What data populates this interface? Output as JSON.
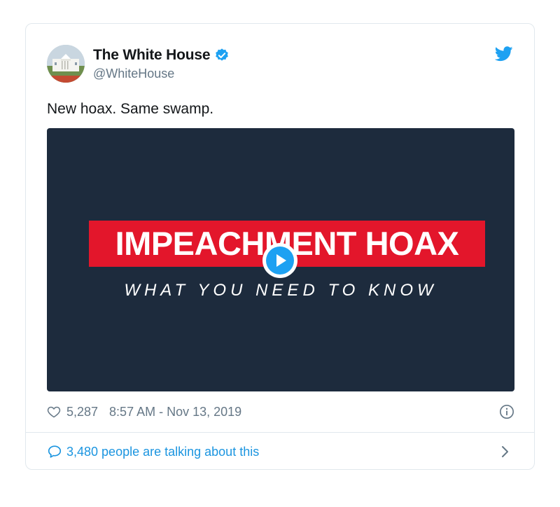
{
  "author": {
    "name": "The White House",
    "handle": "@WhiteHouse"
  },
  "tweet": {
    "text": "New hoax. Same swamp."
  },
  "media": {
    "headline": "IMPEACHMENT HOAX",
    "subheadline": "WHAT YOU NEED TO KNOW"
  },
  "footer": {
    "likes": "5,287",
    "timestamp": "8:57 AM - Nov 13, 2019",
    "talking": "3,480 people are talking about this"
  },
  "icons": {
    "verified": "verified-badge-icon",
    "brand": "twitter-bird-icon",
    "like": "heart-icon",
    "info": "info-icon",
    "reply": "speech-bubble-icon",
    "more": "chevron-right-icon",
    "play": "play-icon"
  },
  "colors": {
    "twitter_blue": "#1da1f2",
    "link_blue": "#1b95e0",
    "media_bg": "#1d2b3d",
    "headline_red": "#e3162b",
    "secondary_text": "#657786",
    "primary_text": "#14171a"
  }
}
